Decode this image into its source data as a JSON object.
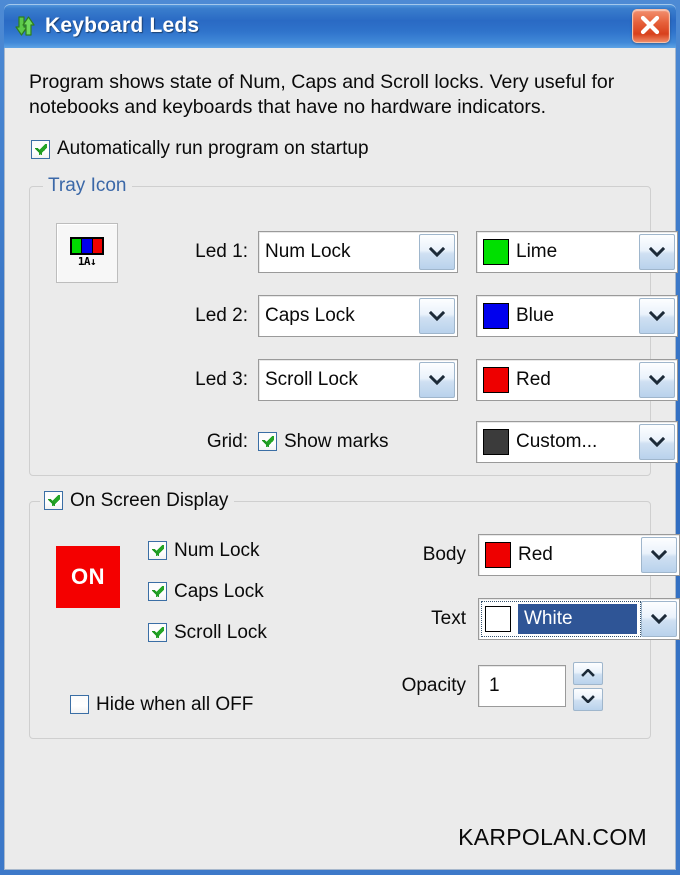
{
  "window": {
    "title": "Keyboard Leds",
    "app_icon": "green-up-down-arrows-icon",
    "close_label": "×",
    "titlebar_color": "#2a6ac4",
    "close_color": "#d8401c"
  },
  "description": "Program shows state of Num, Caps and Scroll locks. Very useful for notebooks and keyboards that have no hardware indicators.",
  "autorun": {
    "label": "Automatically run program on startup",
    "checked": true
  },
  "tray_group": {
    "title": "Tray Icon",
    "title_color": "#3b68a8",
    "preview": {
      "bars": [
        "#00d900",
        "#0000ee",
        "#ee0000"
      ],
      "sub_text": "1A↓"
    },
    "rows": [
      {
        "label": "Led 1:",
        "lock": "Num Lock",
        "color_name": "Lime",
        "color": "#00e000"
      },
      {
        "label": "Led 2:",
        "lock": "Caps Lock",
        "color_name": "Blue",
        "color": "#0000ee"
      },
      {
        "label": "Led 3:",
        "lock": "Scroll Lock",
        "color_name": "Red",
        "color": "#ee0000"
      }
    ],
    "grid": {
      "label": "Grid:",
      "show_marks_label": "Show marks",
      "show_marks_checked": true,
      "color_name": "Custom...",
      "color": "#3b3b3b"
    }
  },
  "osd_group": {
    "title": "On Screen Display",
    "checked": true,
    "preview": {
      "text": "ON",
      "background": "#f40000",
      "text_color": "#ffffff"
    },
    "locks": [
      {
        "label": "Num Lock",
        "checked": true
      },
      {
        "label": "Caps Lock",
        "checked": true
      },
      {
        "label": "Scroll Lock",
        "checked": true
      }
    ],
    "hide_when_off": {
      "label": "Hide when all OFF",
      "checked": false
    },
    "body": {
      "label": "Body",
      "color_name": "Red",
      "color": "#ee0000"
    },
    "text": {
      "label": "Text",
      "color_name": "White",
      "color": "#ffffff",
      "focused": true,
      "highlight": "#2f5596"
    },
    "opacity": {
      "label": "Opacity",
      "value": "1"
    }
  },
  "footer": {
    "text": "KARPOLAN.COM"
  }
}
